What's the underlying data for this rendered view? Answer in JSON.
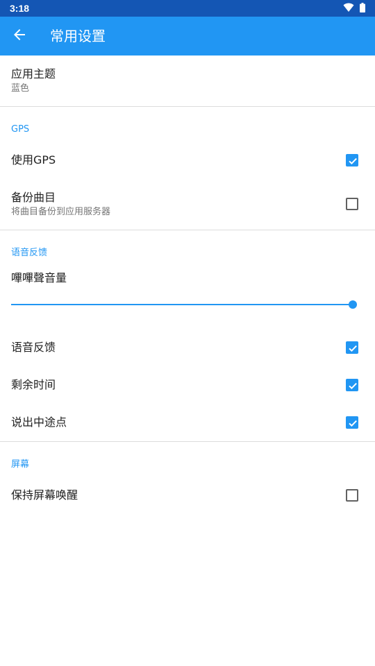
{
  "status_bar": {
    "time": "3:18",
    "icons": [
      "wifi-icon",
      "battery-icon"
    ]
  },
  "app_bar": {
    "title": "常用设置",
    "back_icon": "arrow-left-icon",
    "color": "#2196f3"
  },
  "theme": {
    "title": "应用主题",
    "value": "蓝色"
  },
  "sections": {
    "gps": {
      "header": "GPS",
      "use_gps": {
        "label": "使用GPS",
        "checked": true
      },
      "backup_tracks": {
        "label": "备份曲目",
        "subtitle": "将曲目备份到应用服务器",
        "checked": false
      }
    },
    "voice": {
      "header": "语音反馈",
      "beep_volume": {
        "label": "嗶嗶聲音量",
        "value_fraction": 1.0
      },
      "voice_feedback": {
        "label": "语音反馈",
        "checked": true
      },
      "remaining_time": {
        "label": "剩余时间",
        "checked": true
      },
      "speak_waypoints": {
        "label": "说出中途点",
        "checked": true
      }
    },
    "screen": {
      "header": "屏幕",
      "keep_awake": {
        "label": "保持屏幕唤醒",
        "checked": false
      }
    }
  }
}
